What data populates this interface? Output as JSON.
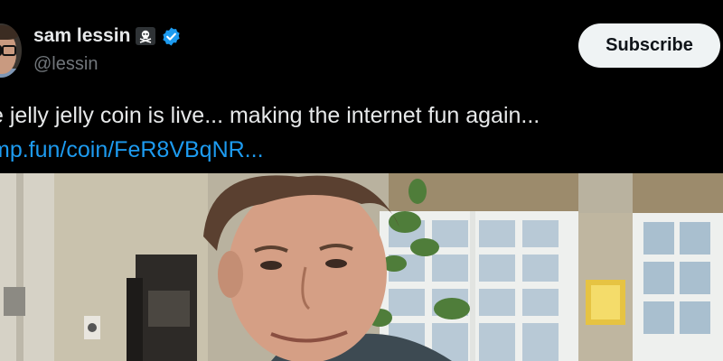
{
  "author": {
    "name": "sam lessin",
    "handle": "@lessin",
    "emoji_icon": "skull-and-crossbones-icon",
    "verified_icon": "verified-badge-icon",
    "verified_color": "#1d9bf0"
  },
  "actions": {
    "subscribe_label": "Subscribe"
  },
  "tweet": {
    "text": "e jelly jelly coin is live... making the internet fun again...",
    "link": "mp.fun/coin/FeR8VBqNR..."
  },
  "colors": {
    "background": "#000000",
    "text_primary": "#e7e9ea",
    "text_secondary": "#71767b",
    "link": "#1d9bf0",
    "button_bg": "#eff3f4"
  },
  "media": {
    "type": "photo"
  }
}
